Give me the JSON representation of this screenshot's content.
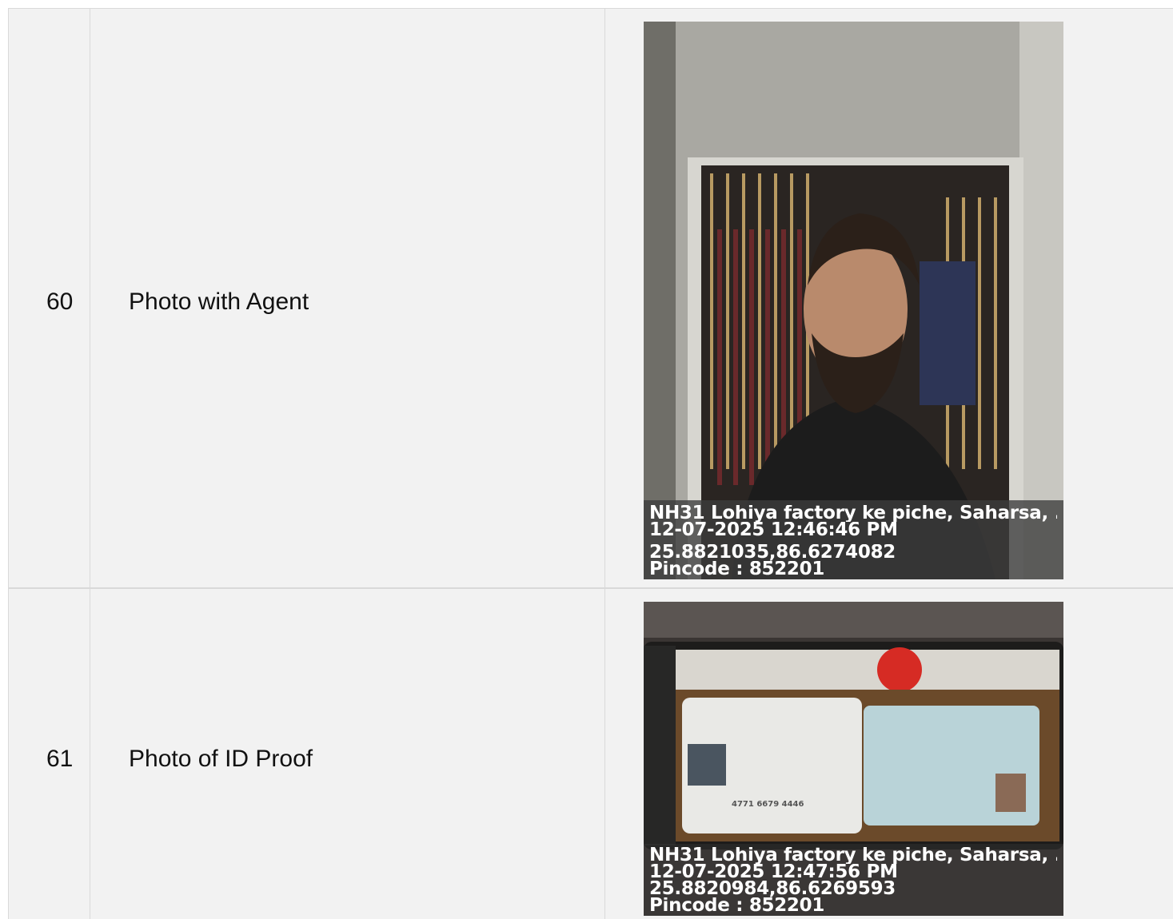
{
  "rows": [
    {
      "number": "60",
      "label": "Photo with Agent",
      "photo": {
        "description_icon": "selfie-photo",
        "stamp": {
          "address": "NH31 Lohiya factory ke piche, Saharsa, ...",
          "datetime": "12-07-2025 12:46:46 PM",
          "coords": "25.8821035,86.6274082",
          "pincode": "Pincode : 852201"
        }
      }
    },
    {
      "number": "61",
      "label": "Photo of ID Proof",
      "photo": {
        "description_icon": "id-card-photo",
        "stamp": {
          "address": "NH31 Lohiya factory ke piche, Saharsa, ...",
          "datetime": "12-07-2025 12:47:56 PM",
          "coords": "25.8820984,86.6269593",
          "pincode": "Pincode : 852201"
        }
      }
    }
  ],
  "colors": {
    "row_bg": "#f2f2f2",
    "border": "#d9d9d9"
  }
}
